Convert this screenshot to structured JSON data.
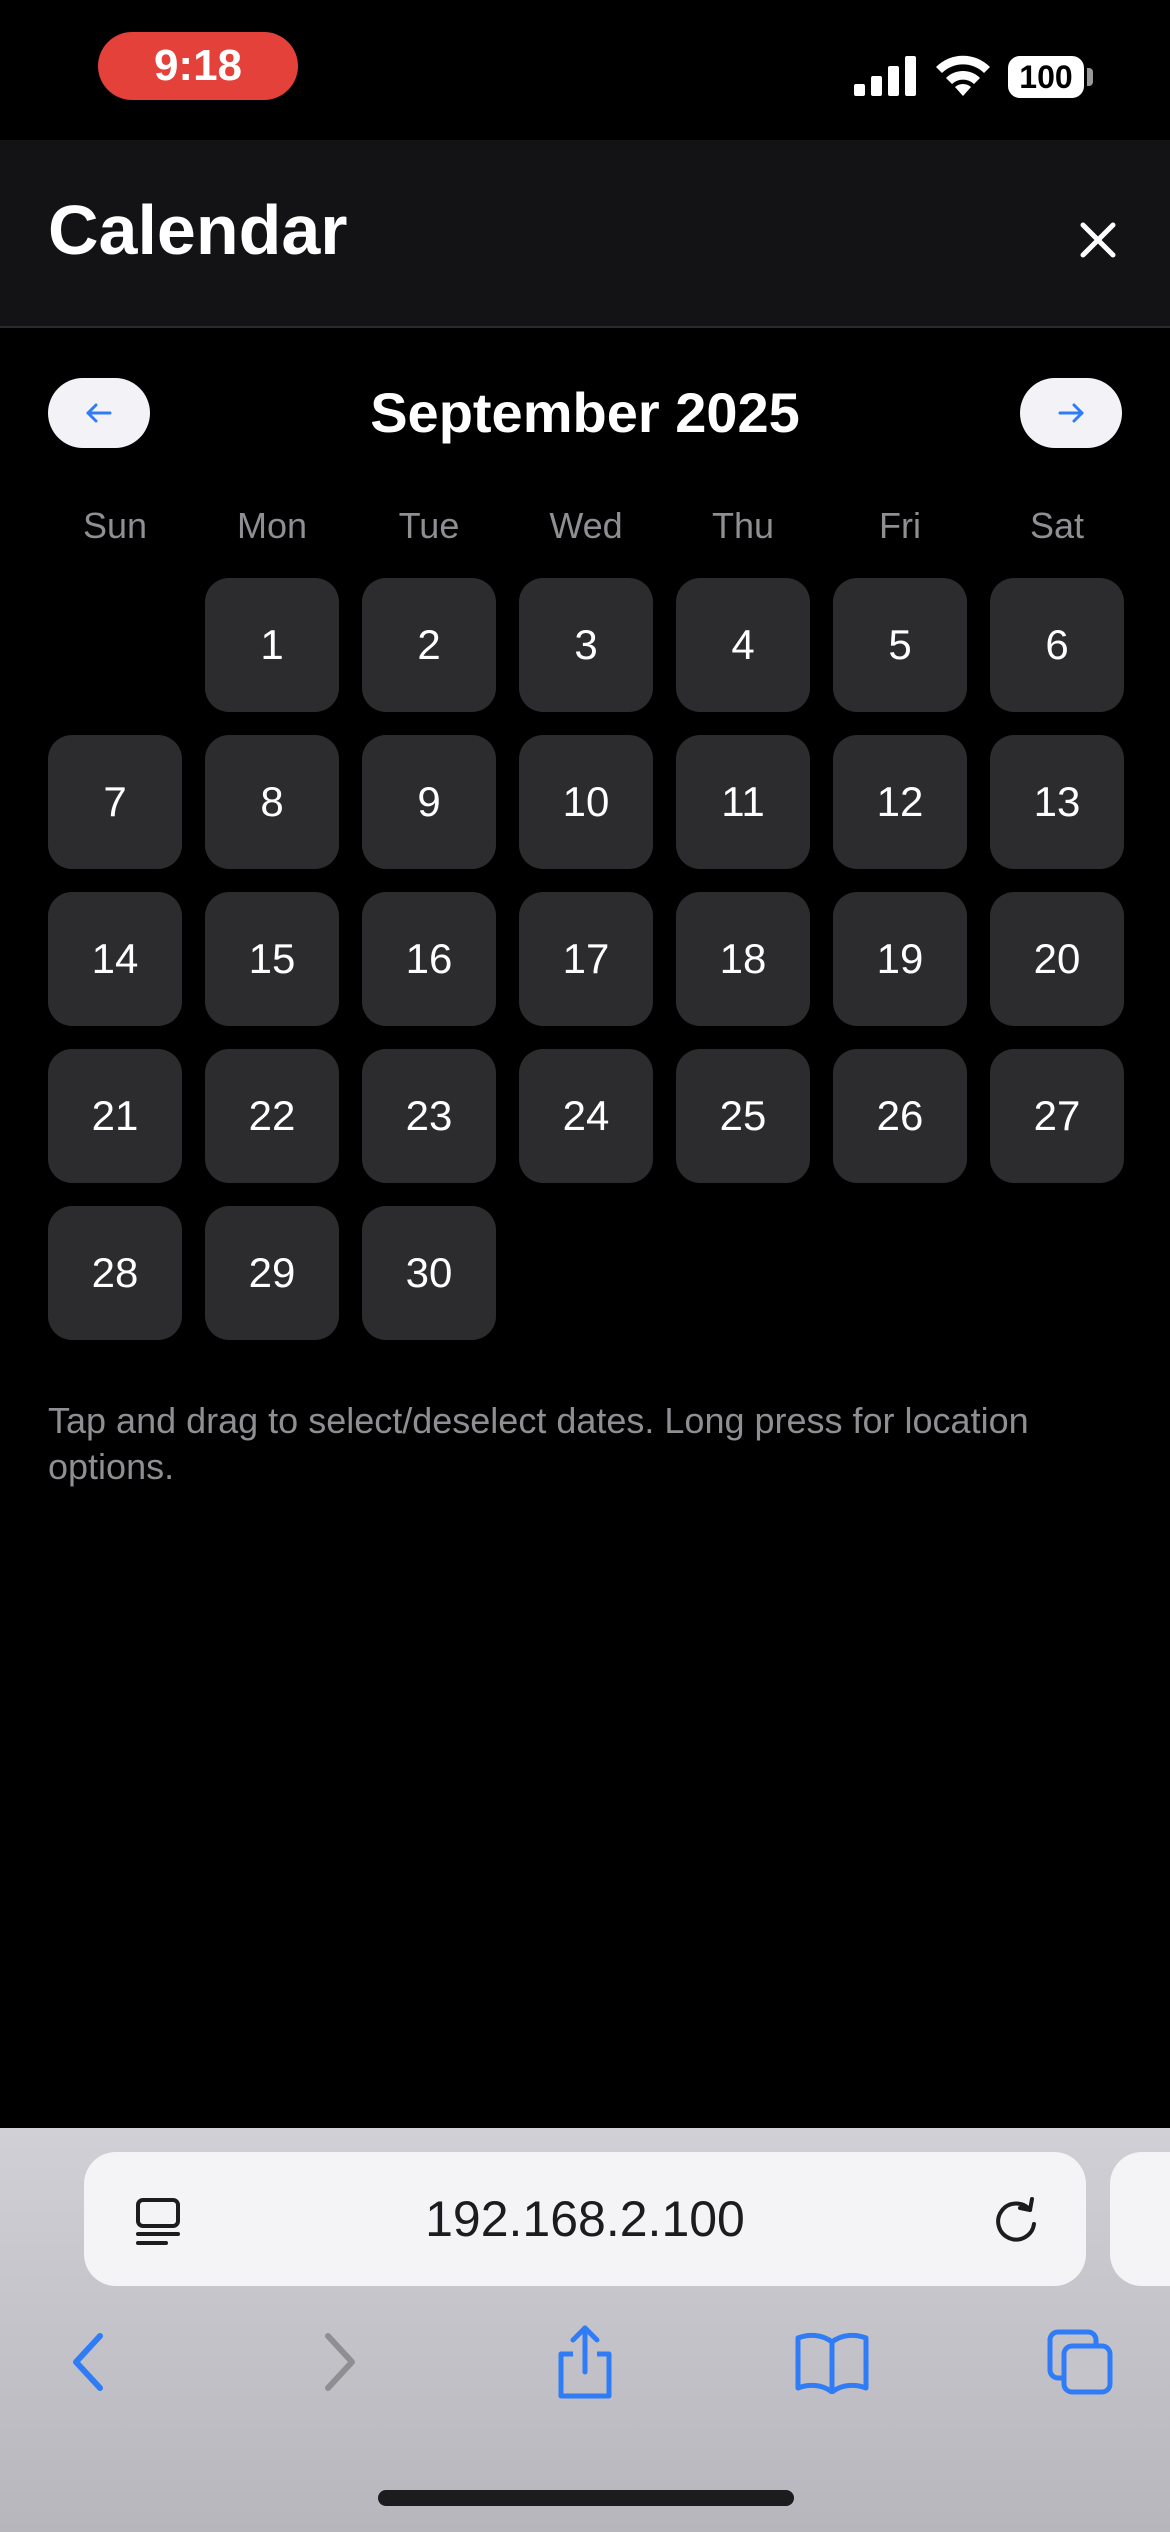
{
  "status_bar": {
    "time": "9:18",
    "battery": "100",
    "time_pill_color": "#e5413b",
    "signal_icon": "cellular-signal-icon",
    "wifi_icon": "wifi-icon"
  },
  "header": {
    "title": "Calendar",
    "close_icon": "close-icon"
  },
  "calendar": {
    "month_title": "September 2025",
    "prev_icon": "arrow-left-icon",
    "next_icon": "arrow-right-icon",
    "accent_color": "#2f7cf6",
    "weekdays": [
      "Sun",
      "Mon",
      "Tue",
      "Wed",
      "Thu",
      "Fri",
      "Sat"
    ],
    "first_weekday_index": 1,
    "days": [
      "1",
      "2",
      "3",
      "4",
      "5",
      "6",
      "7",
      "8",
      "9",
      "10",
      "11",
      "12",
      "13",
      "14",
      "15",
      "16",
      "17",
      "18",
      "19",
      "20",
      "21",
      "22",
      "23",
      "24",
      "25",
      "26",
      "27",
      "28",
      "29",
      "30"
    ],
    "hint": "Tap and drag to select/deselect dates. Long press for location options."
  },
  "browser": {
    "url": "192.168.2.100",
    "reader_icon": "page-menu-icon",
    "reload_icon": "reload-icon",
    "toolbar": [
      "back-icon",
      "forward-icon",
      "share-icon",
      "bookmarks-icon",
      "tabs-icon"
    ],
    "toolbar_color": "#2f7cf6"
  }
}
